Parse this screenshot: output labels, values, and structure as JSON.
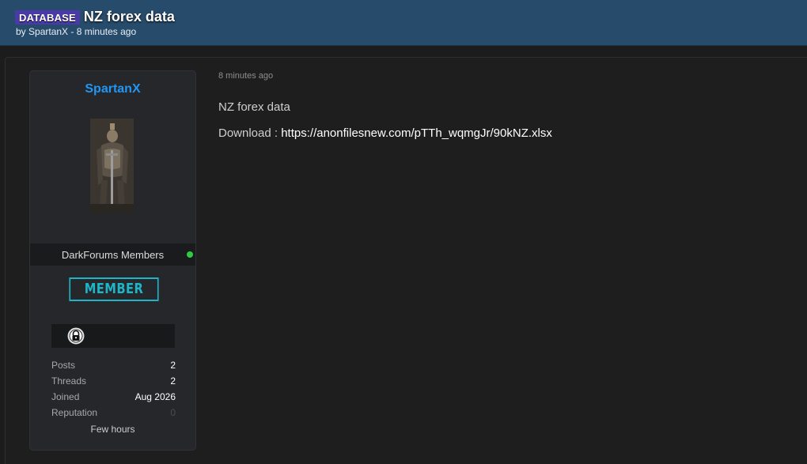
{
  "thread": {
    "prefix": "DATABASE",
    "title": "NZ forex data",
    "author": "SpartanX",
    "age": "8 minutes ago"
  },
  "user_card": {
    "username": "SpartanX",
    "group": "DarkForums Members",
    "rank_badge": "MEMBER",
    "stats": [
      {
        "label": "Posts",
        "value": "2"
      },
      {
        "label": "Threads",
        "value": "2"
      },
      {
        "label": "Joined",
        "value": "Aug 2026"
      },
      {
        "label": "Reputation",
        "value": "0"
      }
    ],
    "status": "Few hours"
  },
  "post": {
    "time": "8 minutes ago",
    "line1": "NZ forex data",
    "download_label": "Download : ",
    "download_link": "https://anonfilesnew.com/pTTh_wqmgJr/90kNZ.xlsx"
  },
  "colors": {
    "header_bg": "#274b6b",
    "prefix_bg": "#4a3aa8",
    "username": "#2196f3",
    "member_badge": "#1fb5c9",
    "online": "#2ecc40"
  },
  "icons": [
    "online-status-icon",
    "award-lock-icon"
  ]
}
